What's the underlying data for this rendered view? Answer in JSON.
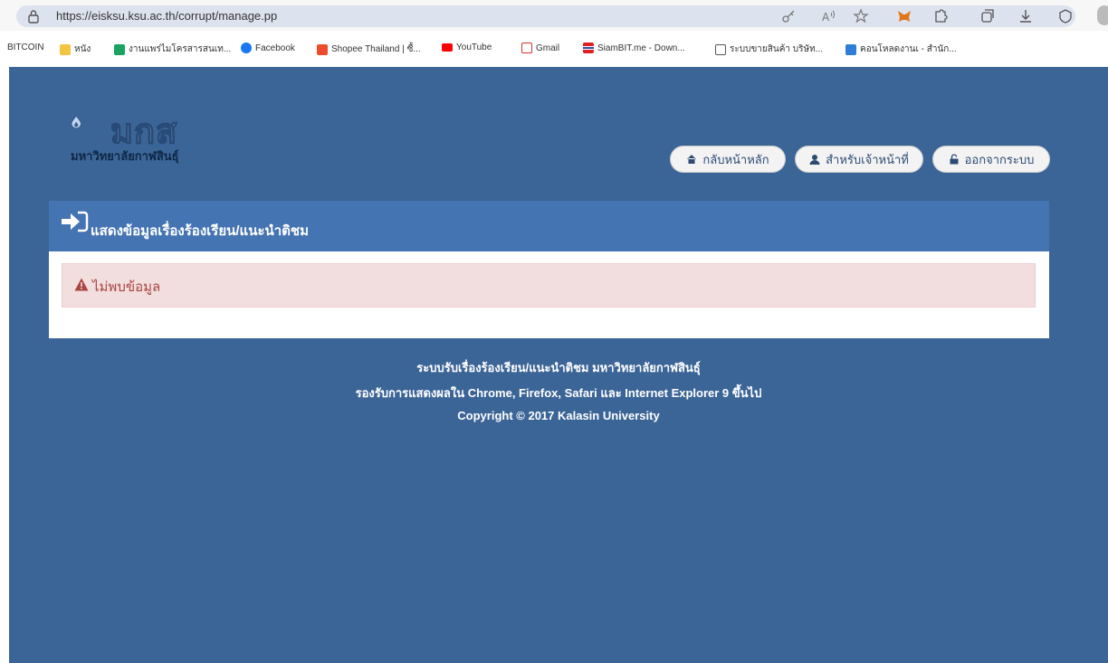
{
  "browser": {
    "url": "https://eisksu.ksu.ac.th/corrupt/manage.pp",
    "bookmarks": [
      {
        "label": "BITCOIN",
        "color": "#ffffff"
      },
      {
        "label": "หนัง",
        "color": "#f4c542"
      },
      {
        "label": "งานแพร่ไมโครสารสนเท...",
        "color": "#1aa260"
      },
      {
        "label": "Facebook",
        "color": "#1877f2"
      },
      {
        "label": "Shopee Thailand | ซื้...",
        "color": "#ee4d2d"
      },
      {
        "label": "YouTube",
        "color": "#ff0000"
      },
      {
        "label": "Gmail",
        "color": "#d93025"
      },
      {
        "label": "SiamBIT.me - Down...",
        "color": "#2b4fa8"
      },
      {
        "label": "ระบบขายสินค้า บริษัท...",
        "color": "#555555"
      },
      {
        "label": "คอนโหลดงานเ - สำนัก...",
        "color": "#2e7dd7"
      }
    ]
  },
  "header": {
    "logo_text": "มกส",
    "logo_subtitle": "มหาวิทยาลัยกาฬสินธุ์",
    "nav": [
      {
        "label": "กลับหน้าหลัก",
        "icon": "home-icon"
      },
      {
        "label": "สำหรับเจ้าหน้าที่",
        "icon": "user-icon"
      },
      {
        "label": "ออกจากระบบ",
        "icon": "unlock-icon"
      }
    ]
  },
  "panel": {
    "title": "แสดงข้อมูลเรื่องร้องเรียน/แนะนำติชม",
    "alert_text": "ไม่พบข้อมูล"
  },
  "footer": {
    "line1": "ระบบรับเรื่องร้องเรียน/แนะนำติชม มหาวิทยาลัยกาฬสินธุ์",
    "line2": "รองรับการแสดงผลใน Chrome, Firefox, Safari และ Internet Explorer 9 ขึ้นไป",
    "line3": "Copyright © 2017 Kalasin University"
  },
  "colors": {
    "page_bg": "#3c6597",
    "panel_header": "#4574b2",
    "alert_bg": "#f2dede",
    "alert_text": "#a94442"
  }
}
